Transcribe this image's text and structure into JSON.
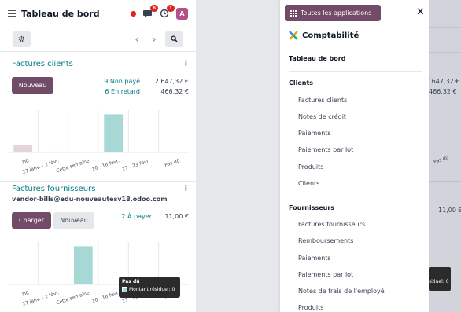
{
  "topbar": {
    "title": "Tableau de bord",
    "chat_badge": "6",
    "activity_badge": "1",
    "avatar_letter": "A"
  },
  "cards": {
    "clients": {
      "title": "Factures clients",
      "new_button": "Nouveau",
      "unpaid_label": "9 Non payé",
      "unpaid_value": "2.647,32 €",
      "late_label": "6 En retard",
      "late_value": "466,32 €",
      "chart_data": {
        "type": "bar",
        "categories": [
          "Dû",
          "27 janv. - 2 févr.",
          "Cette semaine",
          "10 - 16 févr.",
          "17 - 23 févr.",
          "Pas dû"
        ],
        "series": [
          {
            "values": [
              0.18,
              0.02,
              0,
              0.9,
              0,
              0
            ]
          }
        ],
        "colors": [
          "#e5d4da",
          "#e5e7eb",
          "#e5e7eb",
          "#a8d8d6",
          "#e5e7eb",
          "#e5e7eb"
        ]
      }
    },
    "vendors": {
      "title": "Factures fournisseurs",
      "email": "vendor-bills@edu-nouveautesv18.odoo.com",
      "upload_button": "Charger",
      "new_button": "Nouveau",
      "to_pay_label": "2 À payer",
      "to_pay_value": "11,00 €",
      "chart_data": {
        "type": "bar",
        "categories": [
          "Dû",
          "27 janv. - 2 févr.",
          "Cette semaine",
          "10 - 16 févr.",
          "17 - 23 févr.",
          "Pas dû"
        ],
        "series": [
          {
            "values": [
              0,
              0,
              0.9,
              0,
              0,
              0
            ]
          }
        ],
        "colors": [
          "#e5e7eb",
          "#e5e7eb",
          "#a8d8d6",
          "#e5e7eb",
          "#e5e7eb",
          "#e5e7eb"
        ]
      },
      "tooltip": {
        "title": "Pas dû",
        "row": "Montant résiduel: 0"
      }
    }
  },
  "drawer": {
    "all_apps_label": "Toutes les applications",
    "app_name": "Comptabilité",
    "dashboard": "Tableau de bord",
    "clients_header": "Clients",
    "clients_items": [
      "Factures clients",
      "Notes de crédit",
      "Paiements",
      "Paiements par lot",
      "Produits",
      "Clients"
    ],
    "vendors_header": "Fournisseurs",
    "vendors_items": [
      "Factures fournisseurs",
      "Remboursements",
      "Paiements",
      "Paiements par lot",
      "Notes de frais de l'employé",
      "Produits"
    ]
  },
  "background": {
    "value_a": "2.647,32 €",
    "value_b": "466,32 €",
    "tick": "Pas dû",
    "value_c": "11,00 €",
    "tooltip_fragment": "siduel: 0"
  }
}
